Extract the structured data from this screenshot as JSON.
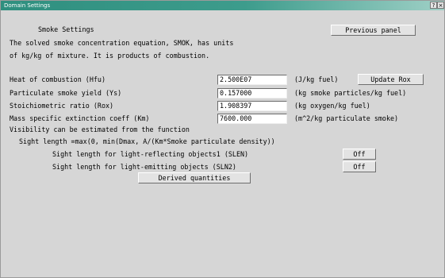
{
  "window": {
    "title": "Domain Settings",
    "help_label": "?",
    "close_label": "×"
  },
  "header": {
    "title": "Smoke Settings",
    "previous_panel_label": "Previous panel"
  },
  "description": [
    "The solved smoke concentration equation, SMOK, has units",
    "of kg/kg of mixture. It is products of combustion."
  ],
  "fields": [
    {
      "label": "Heat of combustion (Hfu)",
      "value": "2.500E07",
      "unit": "(J/kg fuel)"
    },
    {
      "label": "Particulate smoke yield (Ys)",
      "value": "0.157000",
      "unit": "(kg smoke particles/kg fuel)"
    },
    {
      "label": "Stoichiometric ratio (Rox)",
      "value": "1.908397",
      "unit": "(kg oxygen/kg fuel)"
    },
    {
      "label": "Mass specific extinction coeff (Km)",
      "value": "7600.000",
      "unit": "(m^2/kg particulate smoke)"
    }
  ],
  "update_rox_label": "Update Rox",
  "visibility": {
    "line1": "Visibility can be estimated from the function",
    "line2": "Sight length =max(0, min(Dmax, A/(Km*Smoke particulate density))"
  },
  "sight": [
    {
      "label": "Sight length for light-reflecting objects1 (SLEN)",
      "value": "Off"
    },
    {
      "label": "Sight length for light-emitting objects (SLN2)",
      "value": "Off"
    }
  ],
  "derived_label": "Derived quantities"
}
